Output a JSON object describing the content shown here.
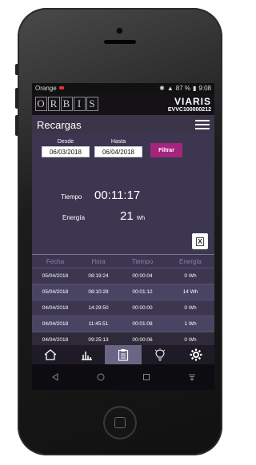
{
  "status_bar": {
    "carrier": "Orange",
    "battery": "87 %",
    "time": "9:08"
  },
  "header": {
    "logo_letters": [
      "O",
      "R",
      "B",
      "I",
      "S"
    ],
    "brand": "VIARIS",
    "device_id": "EVVC100000212"
  },
  "title_bar": {
    "title": "Recargas"
  },
  "filters": {
    "desde_label": "Desde",
    "desde_value": "06/03/2018",
    "hasta_label": "Hasta",
    "hasta_value": "06/04/2018",
    "filter_button": "Filtrar"
  },
  "metrics": {
    "tiempo_label": "Tiempo",
    "tiempo_value": "00:11:17",
    "energia_label": "Energía",
    "energia_value": "21",
    "energia_unit": "Wh"
  },
  "export_icon_label": "X",
  "table": {
    "columns": [
      "Fecha",
      "Hora",
      "Tiempo",
      "Energía"
    ],
    "rows": [
      [
        "05/04/2018",
        "08:19:24",
        "00:00:04",
        "0 Wh"
      ],
      [
        "05/04/2018",
        "08:10:28",
        "00:01:12",
        "14 Wh"
      ],
      [
        "04/04/2018",
        "14:29:50",
        "00:00:00",
        "0 Wh"
      ],
      [
        "04/04/2018",
        "11:45:51",
        "00:01:08",
        "1 Wh"
      ],
      [
        "04/04/2018",
        "09:25:13",
        "00:00:06",
        "0 Wh"
      ]
    ]
  },
  "tabs": [
    {
      "icon": "home-icon"
    },
    {
      "icon": "bar-chart-icon"
    },
    {
      "icon": "clipboard-icon",
      "active": true
    },
    {
      "icon": "lightbulb-icon"
    },
    {
      "icon": "gear-icon"
    }
  ],
  "android_nav": [
    "back-icon",
    "home-circle-icon",
    "recents-icon",
    "notification-icon"
  ],
  "colors": {
    "accent": "#a4247e",
    "background": "#3c3650",
    "header": "#141217"
  }
}
